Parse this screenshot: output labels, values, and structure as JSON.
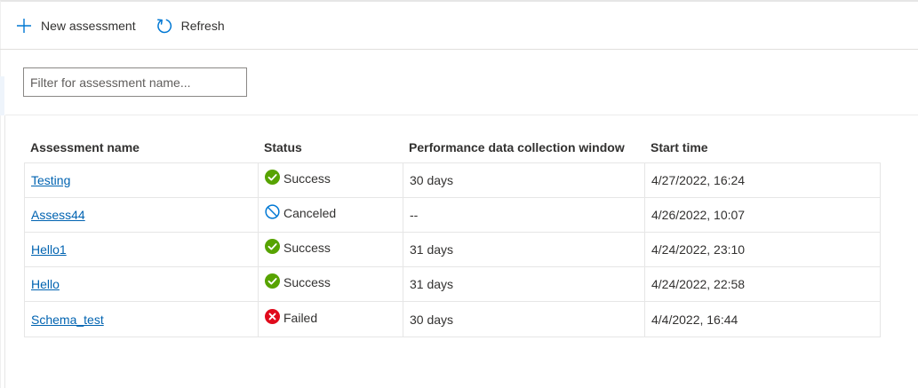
{
  "toolbar": {
    "new_assessment_label": "New assessment",
    "refresh_label": "Refresh"
  },
  "filter": {
    "placeholder": "Filter for assessment name...",
    "value": ""
  },
  "table": {
    "columns": [
      "Assessment name",
      "Status",
      "Performance data collection window",
      "Start time"
    ],
    "rows": [
      {
        "name": "Testing",
        "status": "Success",
        "status_icon": "success-check-icon",
        "window": "30 days",
        "start": "4/27/2022, 16:24"
      },
      {
        "name": "Assess44",
        "status": "Canceled",
        "status_icon": "canceled-icon",
        "window": "--",
        "start": "4/26/2022, 10:07"
      },
      {
        "name": "Hello1",
        "status": "Success",
        "status_icon": "success-check-icon",
        "window": "31 days",
        "start": "4/24/2022, 23:10"
      },
      {
        "name": "Hello",
        "status": "Success",
        "status_icon": "success-check-icon",
        "window": "31 days",
        "start": "4/24/2022, 22:58"
      },
      {
        "name": "Schema_test",
        "status": "Failed",
        "status_icon": "failed-x-icon",
        "window": "30 days",
        "start": "4/4/2022, 16:44"
      }
    ]
  },
  "colors": {
    "accent_blue": "#0078d4",
    "link_blue": "#0063b1",
    "success_green": "#57a300",
    "failed_red": "#e00b1c",
    "text": "#323130",
    "border": "#e6e6e6"
  }
}
